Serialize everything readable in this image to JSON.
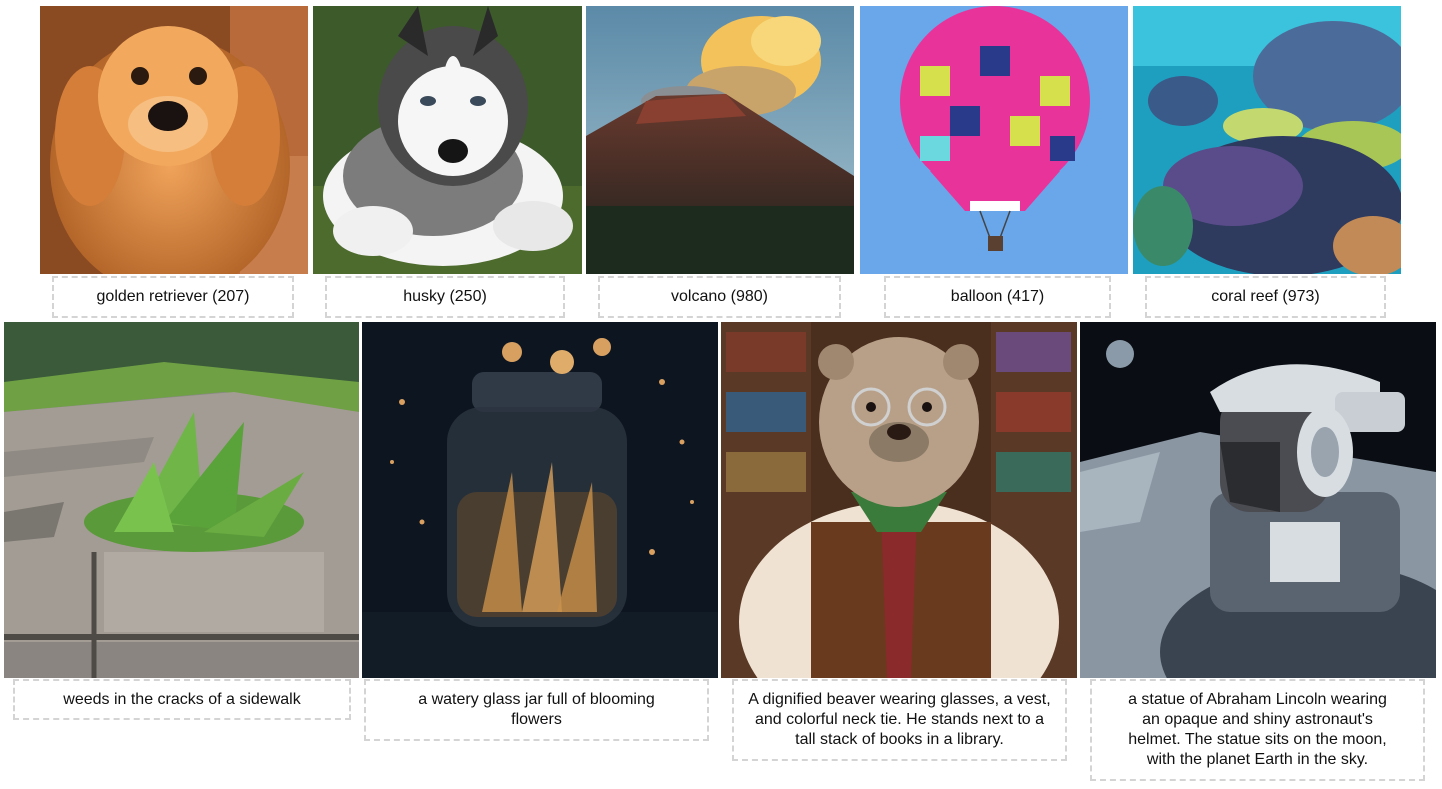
{
  "row1": [
    {
      "caption": "golden retriever (207)",
      "image_icon": "golden-retriever-puppy-icon"
    },
    {
      "caption": "husky (250)",
      "image_icon": "husky-puppy-icon"
    },
    {
      "caption": "volcano (980)",
      "image_icon": "volcano-icon"
    },
    {
      "caption": "balloon (417)",
      "image_icon": "hot-air-balloon-icon"
    },
    {
      "caption": "coral reef (973)",
      "image_icon": "coral-reef-icon"
    }
  ],
  "row2": [
    {
      "caption": "weeds in the cracks of a sidewalk",
      "image_icon": "sidewalk-weeds-icon"
    },
    {
      "caption": "a watery glass jar full of blooming flowers",
      "image_icon": "glass-jar-flowers-icon"
    },
    {
      "caption": "A dignified beaver wearing glasses, a vest, and colorful neck tie. He stands next to a tall stack of books in a library.",
      "image_icon": "beaver-in-library-icon"
    },
    {
      "caption": "a statue of Abraham Lincoln wearing an opaque and shiny astronaut's helmet. The statue sits on the moon, with the planet Earth in the sky.",
      "image_icon": "lincoln-astronaut-statue-icon"
    }
  ],
  "colors": {
    "caption_border": "#d4d4d4",
    "caption_text": "#111111",
    "background": "#ffffff"
  }
}
